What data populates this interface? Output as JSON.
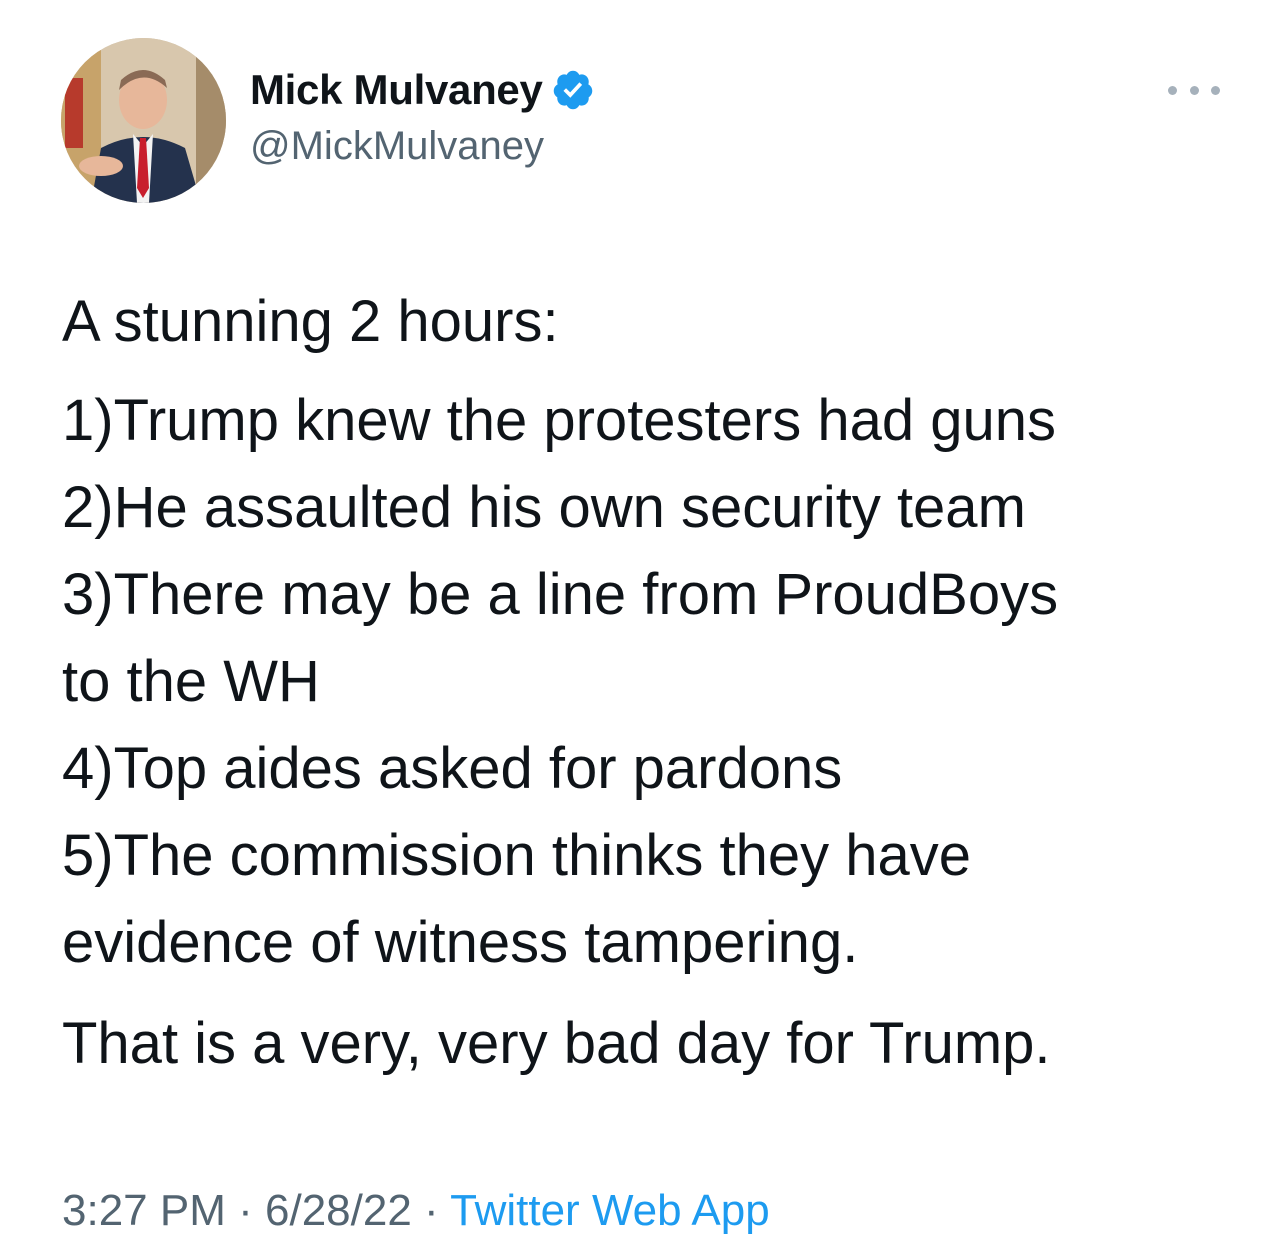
{
  "author": {
    "display_name": "Mick Mulvaney",
    "handle": "@MickMulvaney",
    "verified": true,
    "avatar_icon": "profile-photo"
  },
  "tweet": {
    "intro": "A stunning 2 hours:",
    "lines": [
      "1)Trump knew the protesters had guns",
      "2)He assaulted his own security team",
      "3)There may be a line from ProudBoys",
      "to the WH",
      "4)Top aides asked for pardons",
      "5)The commission thinks they have",
      "evidence of witness tampering."
    ],
    "outro": "That is a very, very bad day for Trump."
  },
  "meta": {
    "time": "3:27 PM",
    "separator": "·",
    "date": "6/28/22",
    "source": "Twitter Web App"
  },
  "colors": {
    "verified_badge": "#1d9bf0",
    "text_primary": "#0f1419",
    "text_secondary": "#536471",
    "link": "#1d9bf0"
  }
}
